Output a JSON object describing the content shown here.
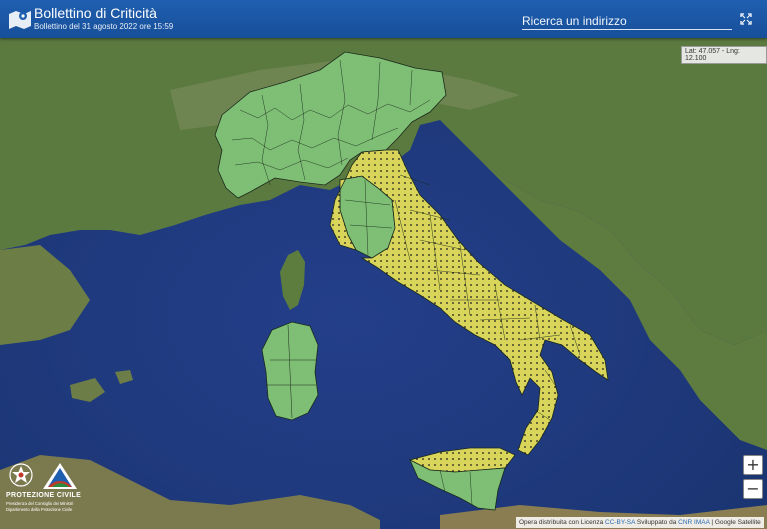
{
  "header": {
    "title": "Bollettino di Criticità",
    "subtitle": "Bollettino del 31 agosto 2022 ore 15:59",
    "search_placeholder": "Ricerca un indirizzo"
  },
  "coordinates_readout": "Lat: 47.057 - Lng: 12.100",
  "zoom": {
    "in_label": "+",
    "out_label": "−"
  },
  "branding": {
    "name": "PROTEZIONE CIVILE",
    "line1": "Presidenza del Consiglio dei Ministri",
    "line2": "Dipartimento della Protezione Civile"
  },
  "attribution": {
    "prefix": "Opera distribuita con Licenza",
    "license": "CC-BY-SA",
    "mid": "Sviluppato da",
    "developer": "CNR IMAA",
    "suffix": "| Google Satellite"
  },
  "map": {
    "colors": {
      "sea": "#1e3f86",
      "land": "#5a7d3e",
      "green_zone": "#7fbf75",
      "yellow_zone": "#d9d45a",
      "border": "#1a2a1a"
    },
    "legend_levels": [
      "green",
      "yellow"
    ]
  }
}
